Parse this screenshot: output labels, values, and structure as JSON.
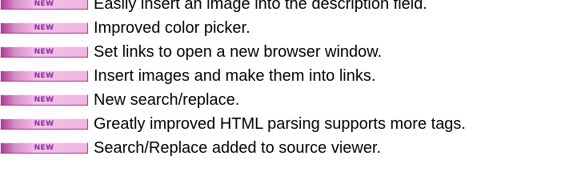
{
  "features": {
    "badge_label": "NEW",
    "badge_color": "#8e2aa0",
    "items": [
      {
        "text": "Easily insert an image into the description field."
      },
      {
        "text": "Improved color picker."
      },
      {
        "text": "Set links to open a new browser window."
      },
      {
        "text": "Insert images and make them into links."
      },
      {
        "text": "New search/replace."
      },
      {
        "text": "Greatly improved HTML parsing supports more tags."
      },
      {
        "text": "Search/Replace added to source viewer."
      }
    ]
  }
}
